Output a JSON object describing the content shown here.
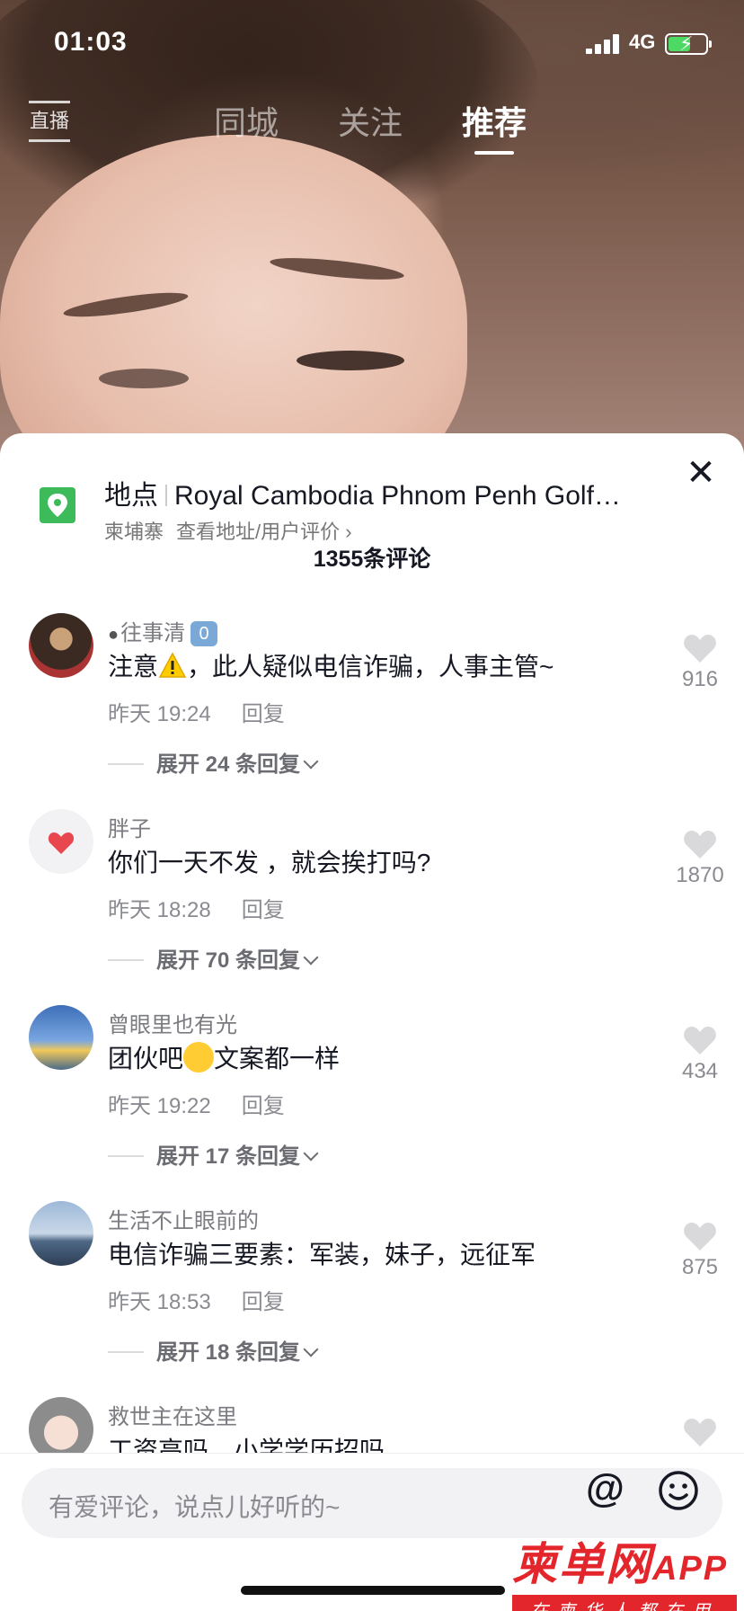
{
  "status_bar": {
    "time": "01:03",
    "network": "4G"
  },
  "top_nav": {
    "live_label": "直播",
    "tabs": [
      {
        "label": "同城",
        "active": false
      },
      {
        "label": "关注",
        "active": false
      },
      {
        "label": "推荐",
        "active": true
      }
    ]
  },
  "location": {
    "label": "地点",
    "name": "Royal Cambodia Phnom Penh Golf…",
    "country": "柬埔寨",
    "link": "查看地址/用户评价 ›"
  },
  "comment_count": "1355条评论",
  "comments": [
    {
      "username": "往事清",
      "badge": "0",
      "text_before": "注意",
      "text_after": "，此人疑似电信诈骗，人事主管~",
      "time": "昨天 19:24",
      "reply": "回复",
      "expand": "展开 24 条回复",
      "likes": "916"
    },
    {
      "username": "胖子",
      "text": "你们一天不发 ，就会挨打吗?",
      "time": "昨天 18:28",
      "reply": "回复",
      "expand": "展开 70 条回复",
      "likes": "1870"
    },
    {
      "username": "曾眼里也有光",
      "text_before": "团伙吧",
      "text_after": "文案都一样",
      "time": "昨天 19:22",
      "reply": "回复",
      "expand": "展开 17 条回复",
      "likes": "434"
    },
    {
      "username": "生活不止眼前的",
      "text": "电信诈骗三要素：军装，妹子，远征军",
      "time": "昨天 18:53",
      "reply": "回复",
      "expand": "展开 18 条回复",
      "likes": "875"
    },
    {
      "username": "救世主在这里",
      "text": "工资高吗，小学学历招吗"
    }
  ],
  "input": {
    "placeholder": "有爱评论，说点儿好听的~"
  },
  "watermark": {
    "title": "柬单网",
    "app": "APP",
    "subtitle": "在柬华人都在用"
  },
  "colors": {
    "like_gray": "#d9d9dc",
    "location_green": "#3dba5a",
    "watermark_red": "#e3262b"
  }
}
